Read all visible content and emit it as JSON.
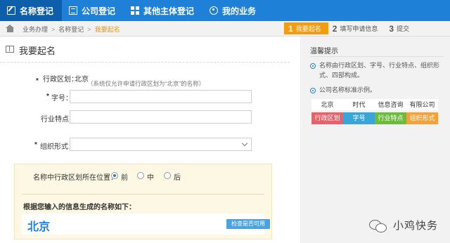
{
  "nav": {
    "items": [
      {
        "label": "名称登记",
        "icon": "edit-icon",
        "active": true
      },
      {
        "label": "公司登记",
        "icon": "building-icon",
        "active": false
      },
      {
        "label": "其他主体登记",
        "icon": "grid-icon",
        "active": false
      },
      {
        "label": "我的业务",
        "icon": "user-icon",
        "active": false
      }
    ]
  },
  "breadcrumb": {
    "items": [
      "业务办理",
      "名称登记",
      "我要起名"
    ],
    "separator": ">"
  },
  "steps": [
    {
      "num": "1",
      "label": "我要起名",
      "active": true
    },
    {
      "num": "2",
      "label": "填写申请信息",
      "active": false
    },
    {
      "num": "3",
      "label": "提交",
      "active": false
    }
  ],
  "main": {
    "title": "我要起名",
    "region_label": "行政区划：",
    "region_value": "北京",
    "region_note": "（系统仅允许申请行政区划为“北京”的名称）",
    "zihao_label": "字号：",
    "zihao_value": "",
    "industry_label": "行业特点：",
    "industry_value": "",
    "org_label": "组织形式：",
    "org_value": "",
    "required_mark": "*"
  },
  "position": {
    "question": "名称中行政区划所在位置：",
    "options": [
      "前",
      "中",
      "后"
    ],
    "selected": "前",
    "result_title": "根据您输入的信息生成的名称如下：",
    "result_name": "北京",
    "check_button": "检查是否可用"
  },
  "sidebar": {
    "title": "温馨提示",
    "tip1": "名称由行政区划、字号、行业特点、组织形式、四部构成。",
    "tip2": "公司名称标准示例。",
    "sample_top": [
      "北京",
      "时代",
      "信息咨询",
      "有限公司"
    ],
    "sample_bottom": [
      "行政区划",
      "字号",
      "行业特点",
      "组织形式"
    ],
    "sample_colors": [
      "#e8606a",
      "#3aa6d8",
      "#6cbb3c",
      "#f3a23a"
    ]
  },
  "watermark": {
    "text": "小鸡快务",
    "icon": "wechat-icon"
  },
  "colors": {
    "nav_bg": "#1e80d7",
    "nav_active": "#0d5fab",
    "step_active": "#f39c12",
    "required": "#e03030"
  }
}
